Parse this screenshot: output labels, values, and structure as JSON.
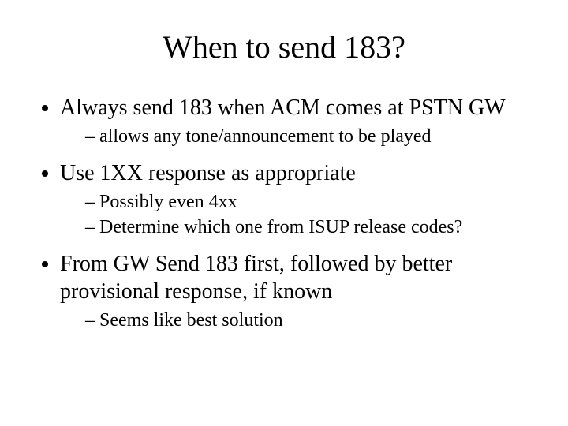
{
  "slide": {
    "title": "When to send 183?",
    "bullets": [
      {
        "text": "Always send 183 when ACM comes at PSTN GW",
        "sub": [
          "allows any tone/announcement to be played"
        ]
      },
      {
        "text": "Use 1XX response as appropriate",
        "sub": [
          "Possibly even 4xx",
          "Determine which one from ISUP release codes?"
        ]
      },
      {
        "text": "From GW Send 183 first, followed by better provisional response, if known",
        "sub": [
          "Seems like best solution"
        ]
      }
    ]
  }
}
